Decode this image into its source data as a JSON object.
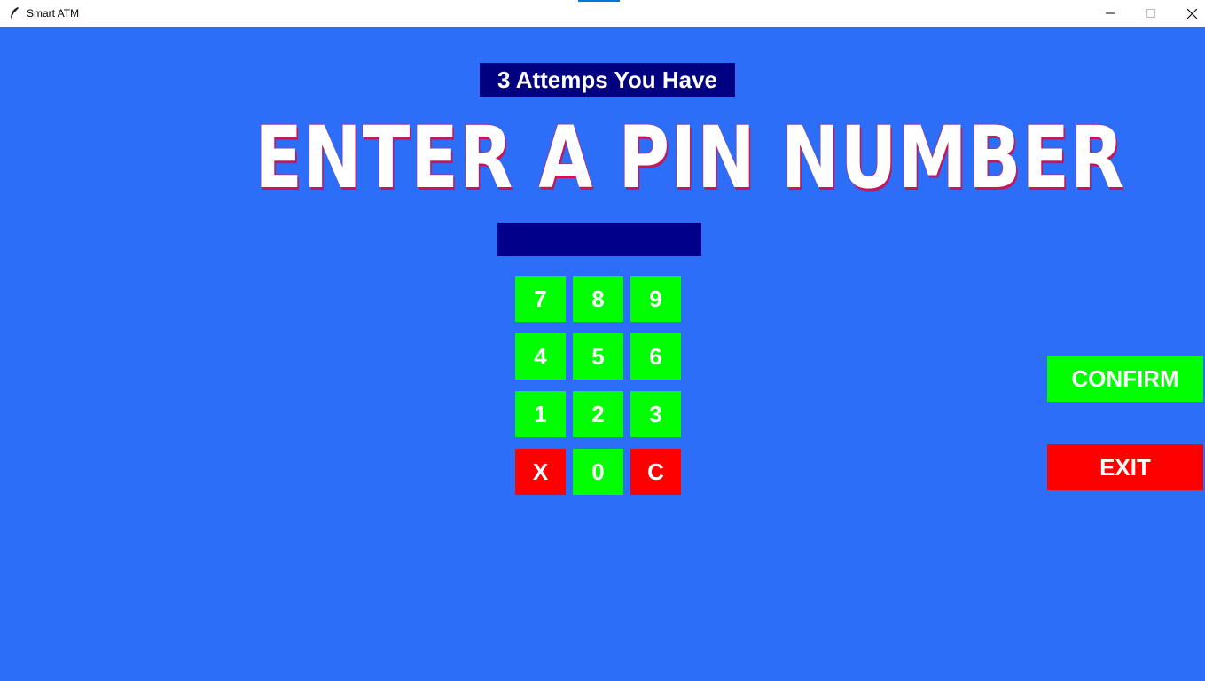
{
  "window": {
    "title": "Smart ATM"
  },
  "attempts_label": "3 Attemps You Have",
  "heading": "ENTER A PIN NUMBER",
  "pin_input": {
    "value": "",
    "placeholder": ""
  },
  "keypad": {
    "k7": "7",
    "k8": "8",
    "k9": "9",
    "k4": "4",
    "k5": "5",
    "k6": "6",
    "k1": "1",
    "k2": "2",
    "k3": "3",
    "kx": "X",
    "k0": "0",
    "kc": "C"
  },
  "actions": {
    "confirm_label": "CONFIRM",
    "exit_label": "EXIT"
  },
  "colors": {
    "background": "#2c6ef7",
    "label_bg": "#000080",
    "input_bg": "#00008b",
    "key_green": "#00ff00",
    "key_red": "#ff0000"
  }
}
